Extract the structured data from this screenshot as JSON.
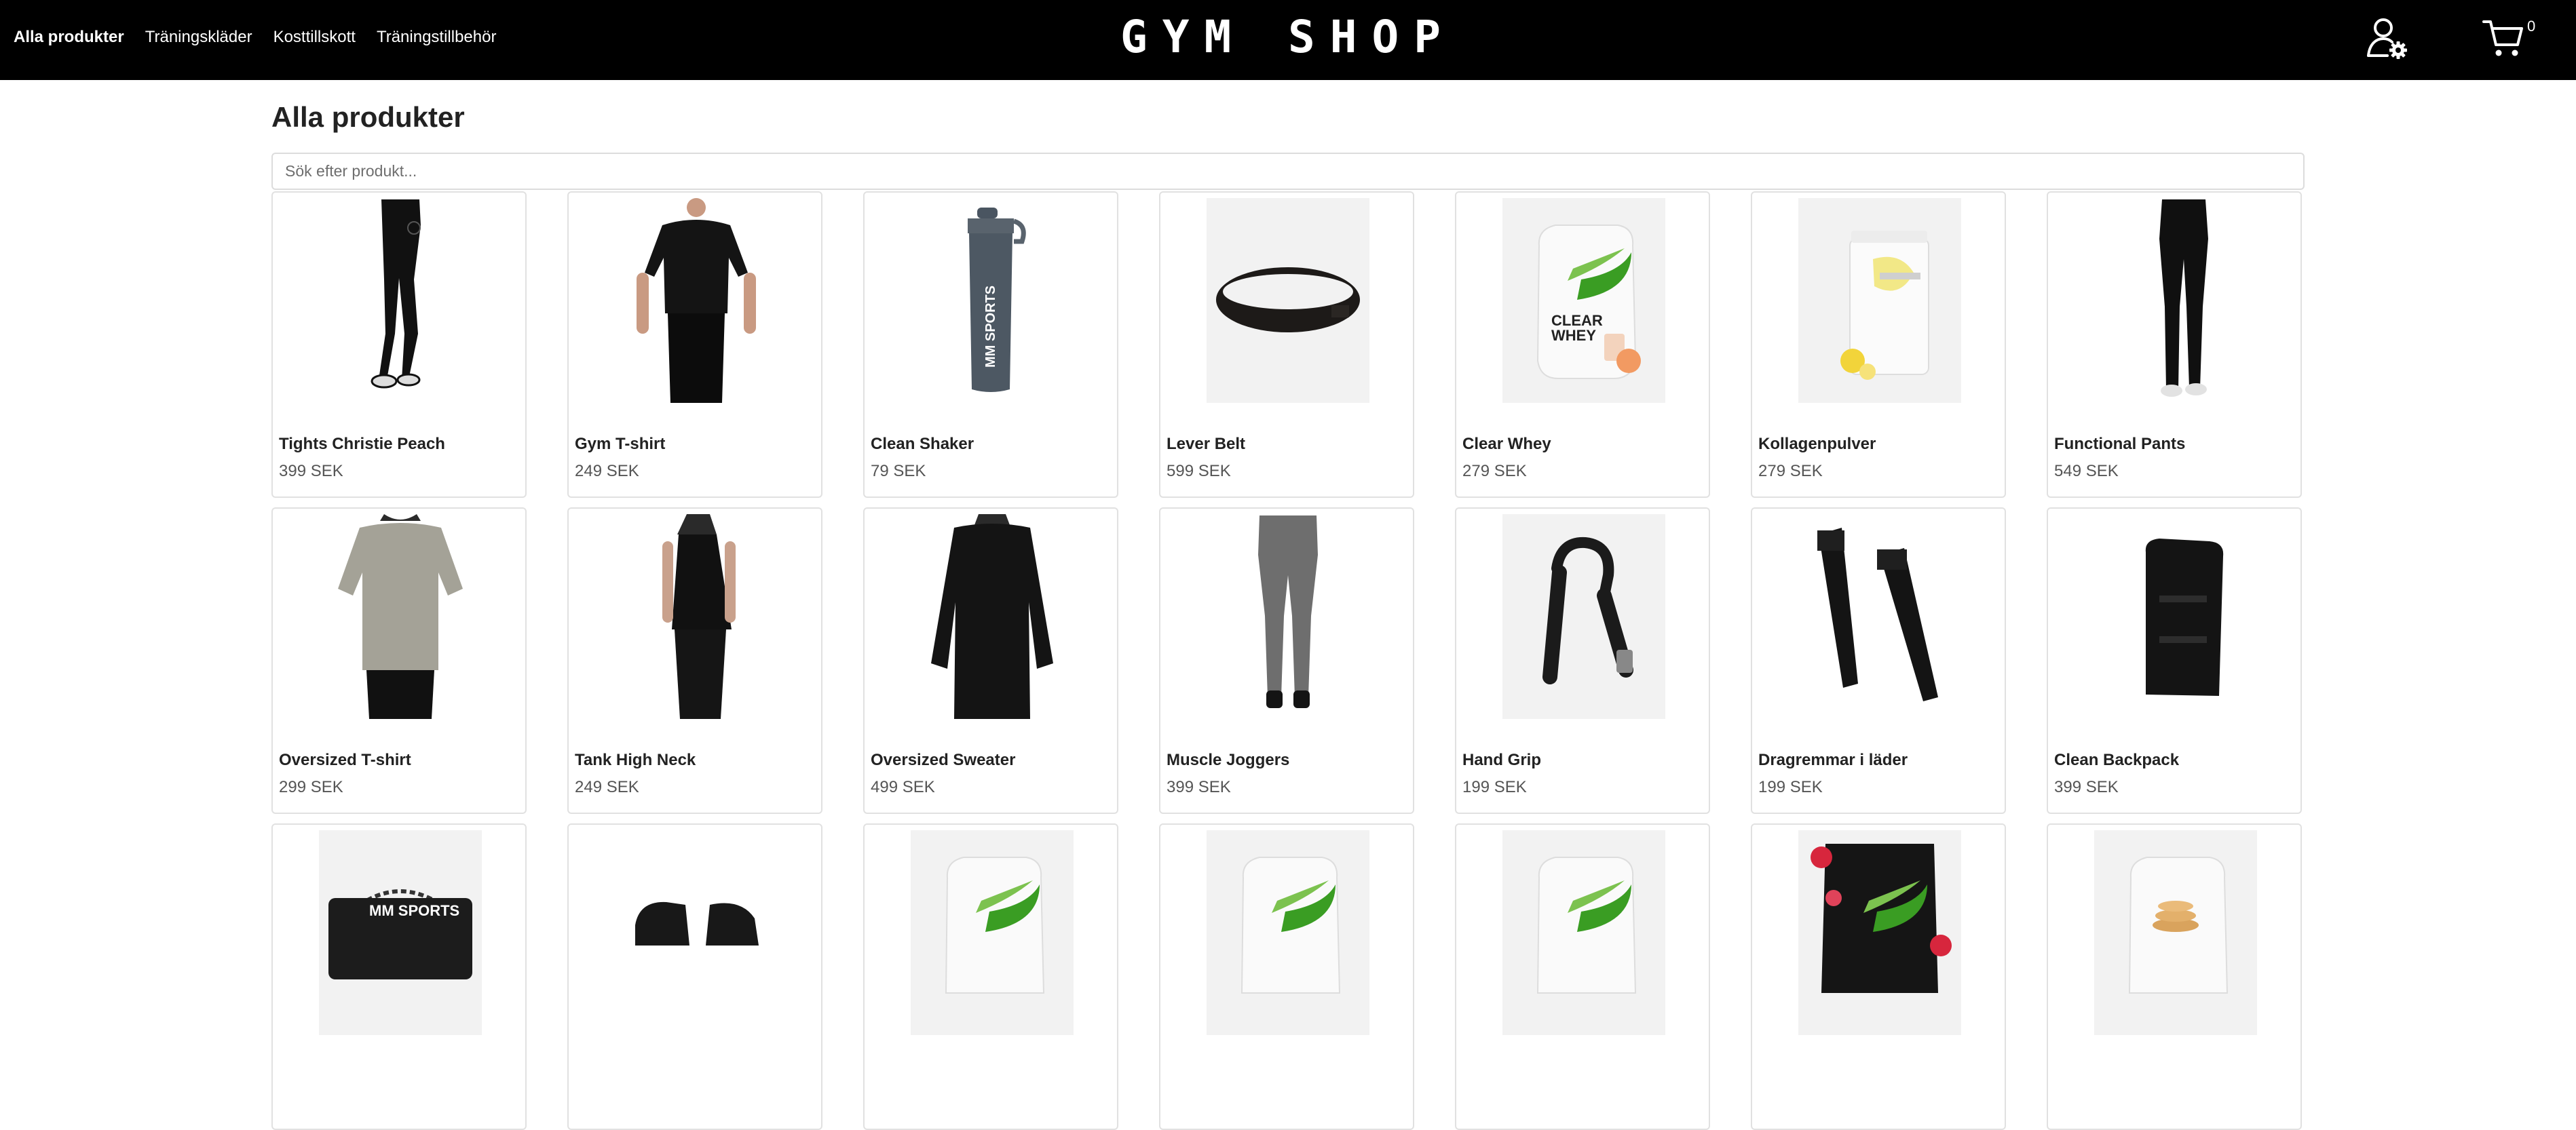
{
  "nav": {
    "items": [
      {
        "label": "Alla produkter",
        "active": true
      },
      {
        "label": "Träningskläder",
        "active": false
      },
      {
        "label": "Kosttillskott",
        "active": false
      },
      {
        "label": "Träningstillbehör",
        "active": false
      }
    ]
  },
  "brand": "GYM SHOP",
  "header_icons": {
    "user": "user-settings-icon",
    "cart": "shopping-cart-icon"
  },
  "cart_count": "0",
  "page_title": "Alla produkter",
  "search": {
    "placeholder": "Sök efter produkt...",
    "value": ""
  },
  "products": [
    {
      "name": "Tights Christie Peach",
      "price": "399 SEK",
      "image": "black-leggings"
    },
    {
      "name": "Gym T-shirt",
      "price": "249 SEK",
      "image": "black-tshirt-man"
    },
    {
      "name": "Clean Shaker",
      "price": "79 SEK",
      "image": "grey-shaker-bottle"
    },
    {
      "name": "Lever Belt",
      "price": "599 SEK",
      "image": "leather-lever-belt"
    },
    {
      "name": "Clear Whey",
      "price": "279 SEK",
      "image": "clear-whey-bag"
    },
    {
      "name": "Kollagenpulver",
      "price": "279 SEK",
      "image": "collagen-tub"
    },
    {
      "name": "Functional Pants",
      "price": "549 SEK",
      "image": "black-pants"
    },
    {
      "name": "Oversized T-shirt",
      "price": "299 SEK",
      "image": "grey-oversized-tshirt"
    },
    {
      "name": "Tank High Neck",
      "price": "249 SEK",
      "image": "black-tank-top"
    },
    {
      "name": "Oversized Sweater",
      "price": "499 SEK",
      "image": "black-sweater"
    },
    {
      "name": "Muscle Joggers",
      "price": "399 SEK",
      "image": "grey-joggers"
    },
    {
      "name": "Hand Grip",
      "price": "199 SEK",
      "image": "hand-grip"
    },
    {
      "name": "Dragremmar i läder",
      "price": "199 SEK",
      "image": "lifting-straps"
    },
    {
      "name": "Clean Backpack",
      "price": "399 SEK",
      "image": "black-backpack"
    },
    {
      "name": "",
      "price": "",
      "image": "mm-sports-belt"
    },
    {
      "name": "",
      "price": "",
      "image": "training-gloves"
    },
    {
      "name": "",
      "price": "",
      "image": "protein-bag"
    },
    {
      "name": "",
      "price": "",
      "image": "protein-bag"
    },
    {
      "name": "",
      "price": "",
      "image": "protein-bag"
    },
    {
      "name": "",
      "price": "",
      "image": "black-protein-bag-strawberry"
    },
    {
      "name": "",
      "price": "",
      "image": "protein-bag-pancake"
    }
  ],
  "colors": {
    "header_bg": "#000000",
    "accent_green": "#3a9d23",
    "text": "#222222",
    "price": "#555555"
  }
}
